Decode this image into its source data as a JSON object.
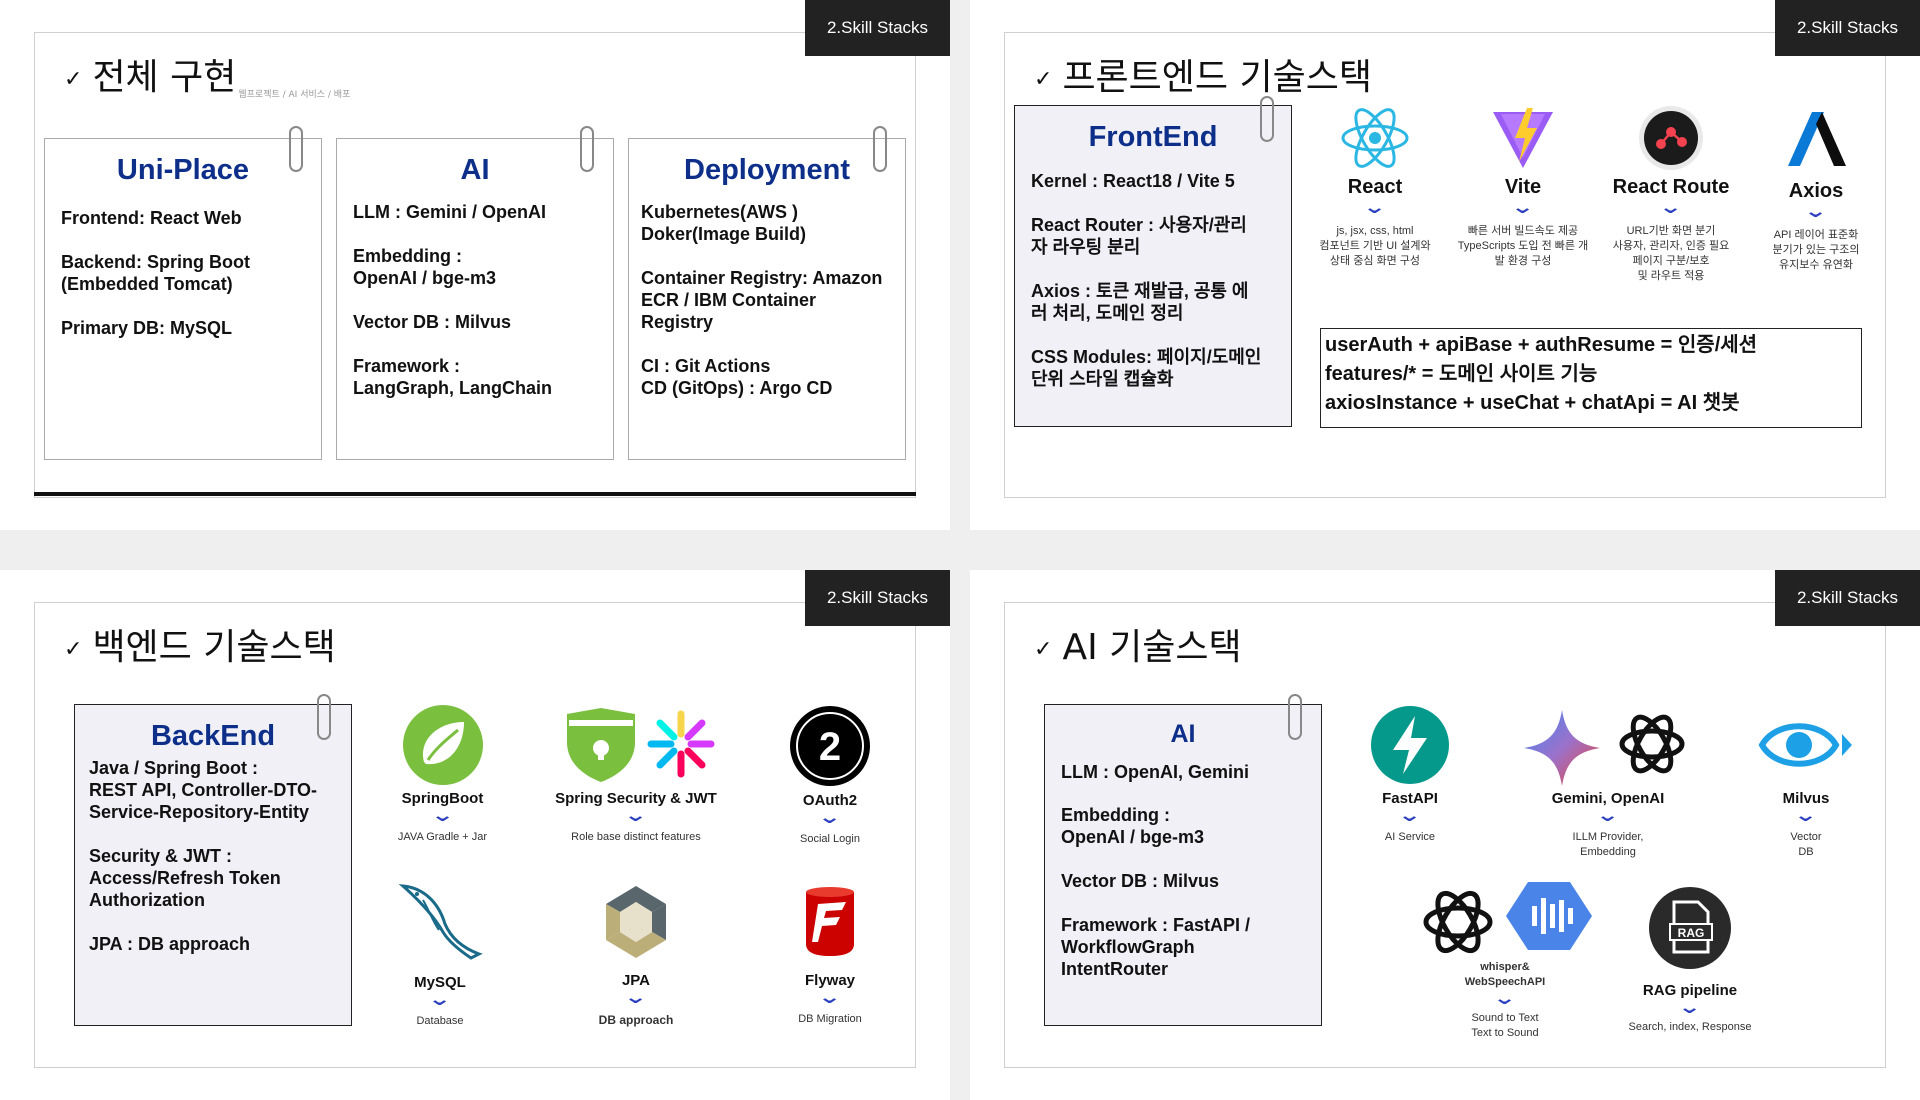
{
  "tag": "2.Skill Stacks",
  "slide1": {
    "title": "전체 구현",
    "subtitle": "웹프로젝트 / AI 서비스 / 배포",
    "cards": [
      {
        "title": "Uni-Place",
        "lines": [
          "Frontend: React Web",
          "Backend: Spring Boot\n(Embedded Tomcat)",
          "Primary DB: MySQL"
        ]
      },
      {
        "title": "AI",
        "lines": [
          "LLM : Gemini / OpenAI",
          "Embedding :\nOpenAI / bge-m3",
          "Vector DB : Milvus",
          "Framework :\nLangGraph, LangChain"
        ]
      },
      {
        "title": "Deployment",
        "lines": [
          " Kubernetes(AWS )\nDoker(Image Build)",
          "Container Registry: Amazon\nECR / IBM Container\nRegistry",
          "CI : Git Actions\nCD (GitOps) : Argo CD"
        ]
      }
    ]
  },
  "slide2": {
    "title": "프론트엔드 기술스택",
    "card": {
      "title": "FrontEnd",
      "lines": [
        "Kernel : React18 / Vite 5",
        "React Router : 사용자/관리\n자 라우팅 분리",
        "Axios : 토큰 재발급, 공통 에\n러 처리, 도메인 정리",
        "CSS Modules: 페이지/도메인\n단위 스타일 캡슐화"
      ]
    },
    "logos": [
      {
        "name": "React",
        "desc": "js, jsx, css, html\n컴포넌트 기반 UI 설계와\n상태 중심 화면 구성",
        "icon": "react-icon"
      },
      {
        "name": "Vite",
        "desc": "빠른 서버 빌드속도 제공\nTypeScripts 도입 전 빠른 개\n발 환경 구성",
        "icon": "vite-icon"
      },
      {
        "name": "React Route",
        "desc": "URL기반 화면 분기\n사용자, 관리자, 인증 필요\n페이지 구분/보호\n및 라우트 적용",
        "icon": "react-router-icon"
      },
      {
        "name": "Axios",
        "desc": "API 레이어 표준화\n분기가 있는 구조의\n유지보수 유연화",
        "icon": "axios-icon"
      }
    ],
    "notes": [
      "userAuth + apiBase + authResume = 인증/세션",
      "features/* = 도메인 사이트 기능",
      "axiosInstance + useChat + chatApi = AI 챗봇"
    ]
  },
  "slide3": {
    "title": "백엔드 기술스택",
    "card": {
      "title": "BackEnd",
      "lines": [
        " Java / Spring Boot :\nREST API, Controller-DTO-\nService-Repository-Entity",
        "Security & JWT  :\nAccess/Refresh Token\nAuthorization",
        "JPA : DB approach"
      ]
    },
    "logos": [
      {
        "name": "SpringBoot",
        "desc": "JAVA Gradle + Jar",
        "icon": "spring-icon"
      },
      {
        "name": "Spring Security & JWT",
        "desc": "Role base distinct features",
        "icon": "security-jwt-icon"
      },
      {
        "name": "OAuth2",
        "desc": "Social Login",
        "icon": "oauth2-icon"
      },
      {
        "name": "MySQL",
        "desc": "Database",
        "icon": "mysql-icon"
      },
      {
        "name": "JPA",
        "desc": "DB approach",
        "icon": "jpa-icon"
      },
      {
        "name": "Flyway",
        "desc": "DB Migration",
        "icon": "flyway-icon"
      }
    ],
    "oauth_badge": "2"
  },
  "slide4": {
    "title": "AI 기술스택",
    "card": {
      "title": "AI",
      "lines": [
        "LLM : OpenAI, Gemini",
        "Embedding :\nOpenAI / bge-m3",
        "Vector DB : Milvus",
        "Framework : FastAPI /\nWorkflowGraph\nIntentRouter"
      ]
    },
    "logos": [
      {
        "name": "FastAPI",
        "desc": "AI Service",
        "icon": "fastapi-icon"
      },
      {
        "name": "Gemini, OpenAI",
        "desc": "ILLM Provider,\nEmbedding",
        "icon": "gemini-openai-icon"
      },
      {
        "name": "Milvus",
        "desc": "Vector\nDB",
        "icon": "milvus-icon"
      },
      {
        "name": "whisper&\nWebSpeechAPI",
        "desc": "Sound to Text\nText to Sound",
        "icon": "whisper-speech-icon"
      },
      {
        "name": "RAG pipeline",
        "desc": "Search, index, Response",
        "icon": "rag-icon"
      }
    ],
    "rag_label": "RAG"
  },
  "colors": {
    "accent": "#0d2f8a",
    "chevron": "#2a3fbf",
    "tag_bg": "#222222"
  }
}
